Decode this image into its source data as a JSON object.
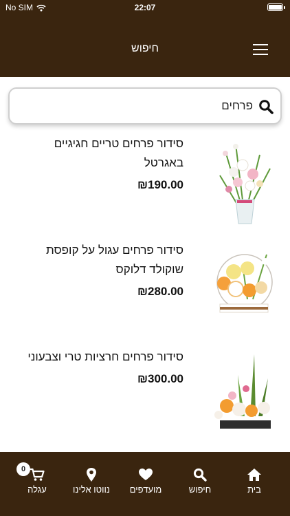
{
  "status_bar": {
    "carrier": "No SIM",
    "time": "22:07"
  },
  "header": {
    "title": "חיפוש",
    "menu_icon": "hamburger-menu-icon"
  },
  "search": {
    "value": "פרחים",
    "icon": "search-icon"
  },
  "products": [
    {
      "name": "סידור פרחים טריים חגיגיים באגרטל",
      "price": "₪190.00"
    },
    {
      "name": "סידור פרחים עגול על קופסת שוקולד דלוקס",
      "price": "₪280.00"
    },
    {
      "name": "סידור פרחים חרציות טרי וצבעוני",
      "price": "₪300.00"
    }
  ],
  "tab_bar": {
    "home": {
      "label": "בית",
      "icon": "home-icon"
    },
    "search": {
      "label": "חיפוש",
      "icon": "search-icon"
    },
    "favorites": {
      "label": "מועדפים",
      "icon": "heart-icon"
    },
    "location": {
      "label": "נווטו אלינו",
      "icon": "location-pin-icon"
    },
    "cart": {
      "label": "עגלה",
      "icon": "cart-icon",
      "badge": "0"
    }
  },
  "colors": {
    "brand": "#3a250f",
    "background": "#ffffff",
    "text": "#111111"
  }
}
